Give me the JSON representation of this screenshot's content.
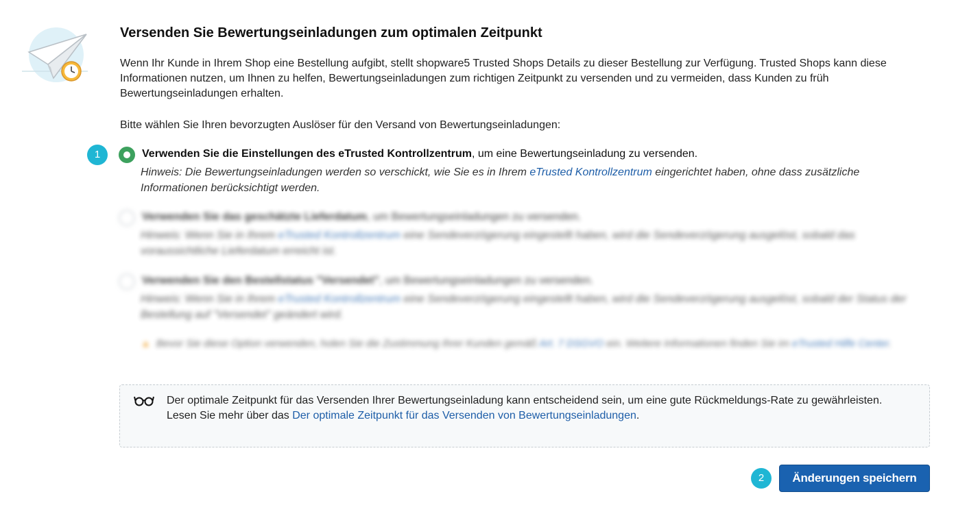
{
  "header": {
    "title": "Versenden Sie Bewertungseinladungen zum optimalen Zeitpunkt",
    "intro": "Wenn Ihr Kunde in Ihrem Shop eine Bestellung aufgibt, stellt shopware5 Trusted Shops Details zu dieser Bestellung zur Verfügung. Trusted Shops kann diese Informationen nutzen, um Ihnen zu helfen, Bewertungseinladungen zum richtigen Zeitpunkt zu versenden und zu vermeiden, dass Kunden zu früh Bewertungseinladungen erhalten.",
    "prompt": "Bitte wählen Sie Ihren bevorzugten Auslöser für den Versand von Bewertungseinladungen:"
  },
  "steps": {
    "first": "1",
    "second": "2"
  },
  "options": [
    {
      "title_bold": "Verwenden Sie die Einstellungen des eTrusted Kontrollzentrum",
      "title_rest": ", um eine Bewertungseinladung zu versenden.",
      "hint_before": "Hinweis: Die Bewertungseinladungen werden so verschickt, wie Sie es in Ihrem ",
      "hint_link": "eTrusted Kontrollzentrum",
      "hint_after": " eingerichtet haben, ohne dass zusätzliche Informationen berücksichtigt werden.",
      "selected": true
    },
    {
      "title_bold": "Verwenden Sie das geschätzte Lieferdatum",
      "title_rest": ", um Bewertungseinladungen zu versenden.",
      "hint_before": "Hinweis: Wenn Sie in Ihrem ",
      "hint_link": "eTrusted Kontrollzentrum",
      "hint_after": " eine Sendeverzögerung eingestellt haben, wird die Sendeverzögerung ausgelöst, sobald das voraussichtliche Lieferdatum erreicht ist.",
      "selected": false
    },
    {
      "title_bold": "Verwenden Sie den Bestellstatus \"Versendet\"",
      "title_rest": ", um Bewertungseinladungen zu versenden.",
      "hint_before": "Hinweis: Wenn Sie in Ihrem ",
      "hint_link": "eTrusted Kontrollzentrum",
      "hint_after": " eine Sendeverzögerung eingestellt haben, wird die Sendeverzögerung ausgelöst, sobald der Status der Bestellung auf \"Versendet\" geändert wird.",
      "selected": false
    }
  ],
  "warning": {
    "icon": "warning-triangle-icon",
    "text_before": "Bevor Sie diese Option verwenden, holen Sie die Zustimmung Ihrer Kunden gemäß ",
    "link1": "Art. 7 DSGVO",
    "text_middle": " ein. Weitere Informationen finden Sie im ",
    "link2": "eTrusted Hilfe Center",
    "text_after": "."
  },
  "info_box": {
    "icon": "glasses-icon",
    "line1": "Der optimale Zeitpunkt für das Versenden Ihrer Bewertungseinladung kann entscheidend sein, um eine gute Rückmeldungs-Rate zu gewährleisten.",
    "line2_before": "Lesen Sie mehr über das ",
    "line2_link": "Der optimale Zeitpunkt für das Versenden von Bewertungseinladungen",
    "line2_after": "."
  },
  "actions": {
    "save_label": "Änderungen speichern"
  },
  "colors": {
    "accent": "#1a62b0",
    "step_badge": "#1fb6d4",
    "radio_selected": "#3da15e",
    "link": "#1e5ea8"
  }
}
